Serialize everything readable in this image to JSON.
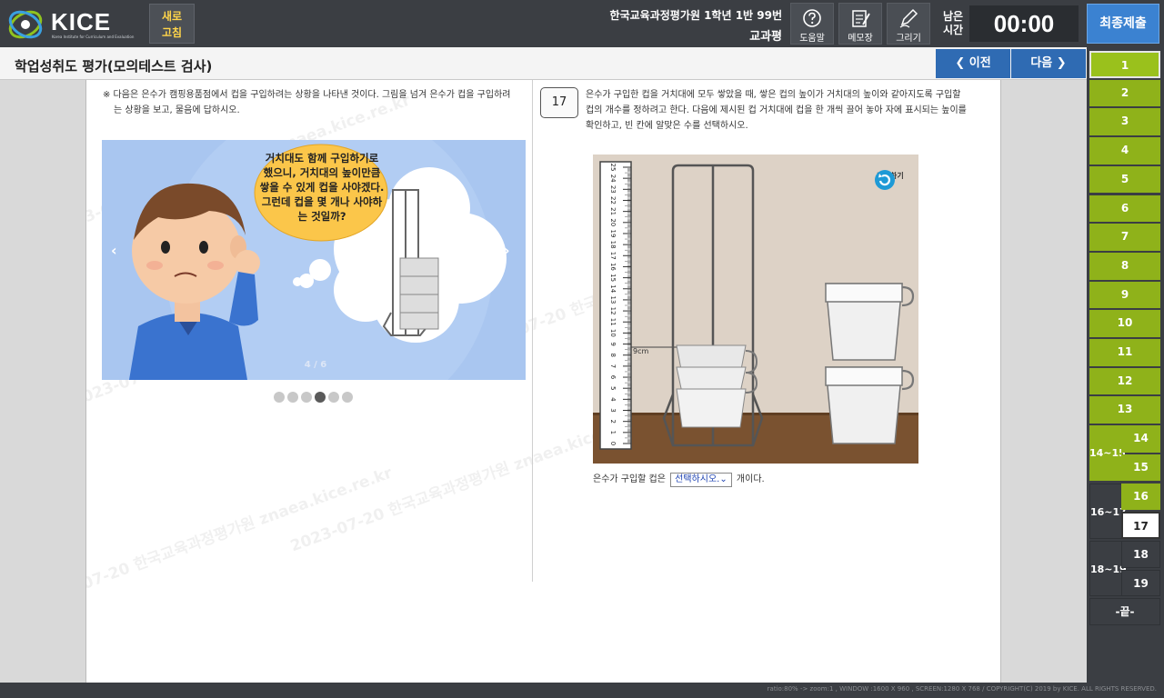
{
  "header": {
    "logo_text": "KICE",
    "logo_subtext": "Korea Institute for Curriculum and Evaluation",
    "refresh_label": "새로\n고침",
    "exam_line1": "한국교육과정평가원 1학년 1반 99번",
    "exam_line2": "교과평",
    "tools": {
      "help": "도움말",
      "memo": "메모장",
      "draw": "그리기"
    },
    "timer_label": "남은\n시간",
    "timer_value": "00:00",
    "final_submit": "최종제출"
  },
  "titlebar": {
    "title": "학업성취도 평가(모의테스트 검사)",
    "prev_label": "이전",
    "next_label": "다음"
  },
  "question": {
    "instruction": "※ 다음은 은수가 캠핑용품점에서 컵을 구입하려는 상황을 나타낸 것이다. 그림을 넘겨 은수가 컵을 구입하려는 상황을 보고, 물음에 답하시오.",
    "bubble_text": "거치대도 함께 구입하기로 했으니, 거치대의 높이만큼 쌓을 수 있게 컵을 사야겠다. 그런데 컵을 몇 개나 사야하는 것일까?",
    "slide_counter": "4 / 6",
    "slide_total": 6,
    "slide_current": 4,
    "number": "17",
    "text": "은수가 구입한 컵을 거치대에 모두 쌓았을 때, 쌓은 컵의 높이가 거치대의 높이와 같아지도록 구입할 컵의 개수를 정하려고 한다. 다음에 제시된 컵 거치대에 컵을 한 개씩 끌어 놓아 자에 표시되는 높이를 확인하고, 빈 칸에 알맞은 수를 선택하시오.",
    "ruler_mark": "9cm",
    "ruler_ticks": [
      "25",
      "24",
      "23",
      "22",
      "21",
      "20",
      "19",
      "18",
      "17",
      "16",
      "15",
      "14",
      "13",
      "12",
      "11",
      "10",
      "9",
      "8",
      "7",
      "6",
      "5",
      "4",
      "3",
      "2",
      "1",
      "0"
    ],
    "retry_label": "다시하기",
    "answer_prefix": "은수가 구입할 컵은",
    "answer_select": "선택하시오.",
    "answer_suffix": "개이다.",
    "watermark": "2023-07-20 한국교육과정평가원 znaea.kice.re.kr"
  },
  "nav": {
    "items": [
      "1",
      "2",
      "3",
      "4",
      "5",
      "6",
      "7",
      "8",
      "9",
      "10",
      "11",
      "12",
      "13"
    ],
    "groups": [
      {
        "label": "14~15",
        "items": [
          "14",
          "15"
        ]
      },
      {
        "label": "16~17",
        "items": [
          "16",
          "17"
        ]
      },
      {
        "label": "18~19",
        "items": [
          "18",
          "19"
        ]
      }
    ],
    "end_label": "-끝-",
    "current": "17"
  },
  "footer": {
    "text": "ratio:80% -> zoom:1 , WINDOW :1600 X 960 , SCREEN:1280 X 768 / COPYRIGHT(C) 2019 by KICE. ALL RIGHTS RESERVED."
  },
  "colors": {
    "topbar": "#3b3e43",
    "nav_answered": "#8fb21a",
    "nav_button": "#2f6bb3",
    "submit": "#3b82d1",
    "refresh_text": "#ffd54a"
  }
}
